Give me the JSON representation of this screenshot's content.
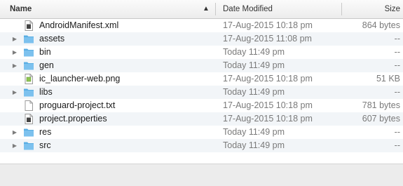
{
  "header": {
    "name": "Name",
    "date": "Date Modified",
    "size": "Size",
    "sort": "▲"
  },
  "colors": {
    "folder": "#5aaee3",
    "folder_tab": "#7cc1ee",
    "row_alt": "#f2f5f8"
  },
  "files": [
    {
      "name": "AndroidManifest.xml",
      "date": "17-Aug-2015 10:18 pm",
      "size": "864 bytes",
      "icon": "xml-file-icon",
      "expandable": false
    },
    {
      "name": "assets",
      "date": "17-Aug-2015 11:08 pm",
      "size": "--",
      "icon": "folder-icon",
      "expandable": true
    },
    {
      "name": "bin",
      "date": "Today 11:49 pm",
      "size": "--",
      "icon": "folder-icon",
      "expandable": true
    },
    {
      "name": "gen",
      "date": "Today 11:49 pm",
      "size": "--",
      "icon": "folder-icon",
      "expandable": true
    },
    {
      "name": "ic_launcher-web.png",
      "date": "17-Aug-2015 10:18 pm",
      "size": "51 KB",
      "icon": "image-file-icon",
      "expandable": false
    },
    {
      "name": "libs",
      "date": "Today 11:49 pm",
      "size": "--",
      "icon": "folder-icon",
      "expandable": true
    },
    {
      "name": "proguard-project.txt",
      "date": "17-Aug-2015 10:18 pm",
      "size": "781 bytes",
      "icon": "text-file-icon",
      "expandable": false
    },
    {
      "name": "project.properties",
      "date": "17-Aug-2015 10:18 pm",
      "size": "607 bytes",
      "icon": "properties-file-icon",
      "expandable": false
    },
    {
      "name": "res",
      "date": "Today 11:49 pm",
      "size": "--",
      "icon": "folder-icon",
      "expandable": true
    },
    {
      "name": "src",
      "date": "Today 11:49 pm",
      "size": "--",
      "icon": "folder-icon",
      "expandable": true
    }
  ]
}
